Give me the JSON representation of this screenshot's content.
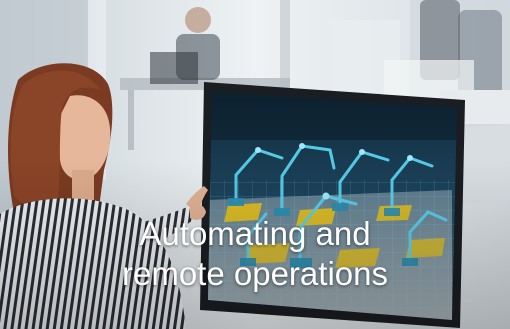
{
  "card": {
    "caption_line1": "Automating and",
    "caption_line2": "remote operations"
  },
  "scene": {
    "subject": "woman-touching-monitor",
    "screen_content": "industrial-robot-arms-wireframe",
    "colors": {
      "background": "#dfe6ea",
      "monitor_bezel": "#1a1d22",
      "screen_glow": "#2fb6d8",
      "robot_accent": "#e8c21a",
      "shirt_stripes": "#2a2f38",
      "hair": "#7a3b22",
      "caption_text": "#ffffff"
    }
  }
}
